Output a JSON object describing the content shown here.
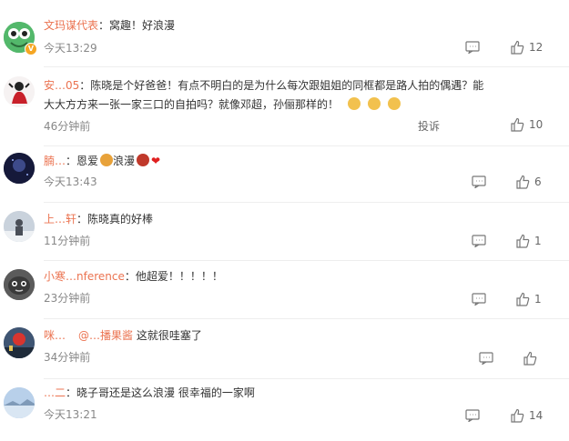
{
  "comments": [
    {
      "username": "文玛谋代表",
      "text": "：窝趣！好浪漫",
      "time": "今天13:29",
      "likes": "12",
      "avatar": "frog-avatar",
      "verified": true
    },
    {
      "username": "安…05",
      "text": "：陈晓是个好爸爸！有点不明白的是为什么每次跟姐姐的同框都是路人拍的偶遇？能",
      "text2": "大大方方来一张一家三口的自拍吗？就像邓超，孙俪那样的！",
      "time": "46分钟前",
      "report": "投诉",
      "likes": "10",
      "avatar": "figure-avatar",
      "emoji_count": 3
    },
    {
      "username": "腩…",
      "text": "：恩爱",
      "text_b": "浪漫",
      "time": "今天13:43",
      "likes": "6",
      "avatar": "dark-avatar"
    },
    {
      "username": "上…轩",
      "text": "：陈晓真的好棒",
      "time": "11分钟前",
      "likes": "1",
      "avatar": "snow-avatar"
    },
    {
      "username": "小寒…nference",
      "text": "：他超爱！！！！！",
      "time": "23分钟前",
      "likes": "1",
      "avatar": "cartoon-avatar"
    },
    {
      "username": "咪…",
      "mention": "@…播果酱",
      "text": " 这就很哇塞了",
      "time": "34分钟前",
      "likes": "",
      "avatar": "scene-avatar"
    },
    {
      "username": "…二",
      "text": "：晓子哥还是这么浪漫 很幸福的一家啊",
      "time": "今天13:21",
      "likes": "14",
      "avatar": "sky-avatar"
    }
  ],
  "colors": {
    "username": "#eb7350",
    "text": "#333333",
    "meta": "#888888",
    "divider": "#eeeeee"
  }
}
